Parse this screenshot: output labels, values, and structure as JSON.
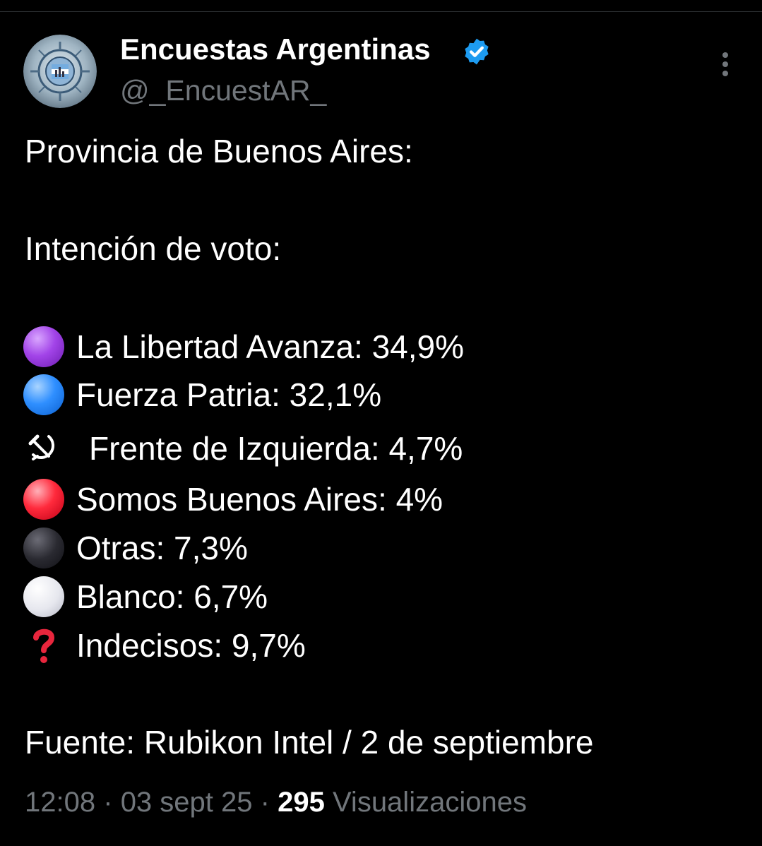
{
  "author": {
    "name": "Encuestas Argentinas",
    "handle": "@_EncuestAR_"
  },
  "post": {
    "lines": [
      "Provincia de Buenos Aires:",
      "Intención de voto:"
    ],
    "results": [
      {
        "icon": "purple-circle-icon",
        "color": "#a244e8",
        "text": "La Libertad Avanza: 34,9%"
      },
      {
        "icon": "blue-circle-icon",
        "color": "#2f8fff",
        "text": "Fuerza Patria: 32,1%"
      },
      {
        "icon": "hammer-sickle-icon",
        "color": "#ffffff",
        "text": "Frente de Izquierda: 4,7%"
      },
      {
        "icon": "red-circle-icon",
        "color": "#ff2a3c",
        "text": "Somos Buenos Aires: 4%"
      },
      {
        "icon": "black-circle-icon",
        "color": "#2a2a31",
        "text": "Otras: 7,3%"
      },
      {
        "icon": "white-circle-icon",
        "color": "#e6e7ee",
        "text": "Blanco: 6,7%"
      },
      {
        "icon": "red-question-mark-icon",
        "color": "#e8263d",
        "text": "Indecisos: 9,7%"
      }
    ],
    "source": "Fuente: Rubikon Intel / 2 de septiembre"
  },
  "meta": {
    "time": "12:08",
    "separator": "·",
    "date": "03 sept 25",
    "views_count": "295",
    "views_label": "Visualizaciones"
  },
  "colors": {
    "background": "#000000",
    "secondary_text": "#71767b",
    "verified_blue": "#1d9bf0"
  }
}
